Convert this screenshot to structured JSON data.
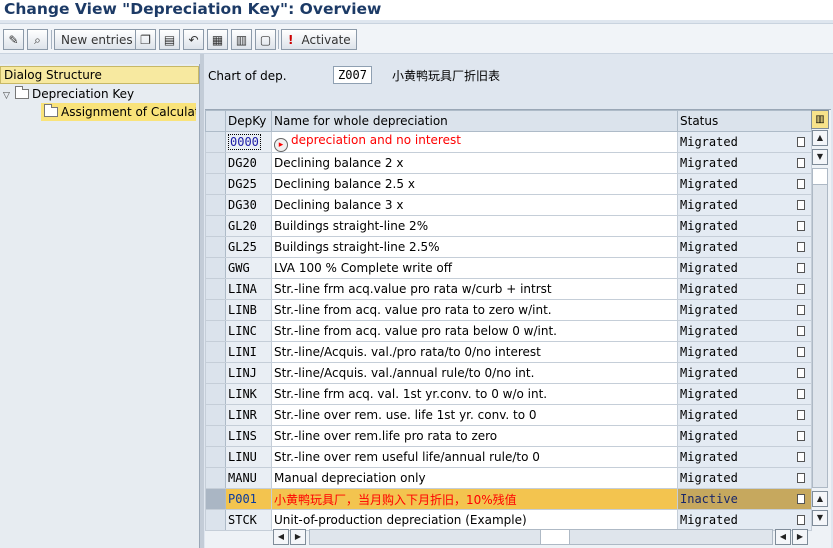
{
  "title": "Change View \"Depreciation Key\": Overview",
  "toolbar": {
    "new_entries_label": "New entries",
    "activate_label": "Activate"
  },
  "dialog_structure": {
    "header": "Dialog Structure",
    "nodes": [
      {
        "label": "Depreciation Key",
        "expanded": true
      },
      {
        "label": "Assignment of Calculatio",
        "selected": true
      }
    ]
  },
  "chart_of_dep": {
    "label": "Chart of dep.",
    "value": "Z007",
    "description": "小黄鸭玩具厂折旧表"
  },
  "table": {
    "columns": [
      "DepKy",
      "Name for whole depreciation",
      "Status"
    ],
    "rows": [
      {
        "key": "0000",
        "name": "depreciation and no interest",
        "status": "Migrated"
      },
      {
        "key": "DG20",
        "name": "Declining balance 2 x",
        "status": "Migrated"
      },
      {
        "key": "DG25",
        "name": "Declining balance 2.5 x",
        "status": "Migrated"
      },
      {
        "key": "DG30",
        "name": "Declining balance 3 x",
        "status": "Migrated"
      },
      {
        "key": "GL20",
        "name": "Buildings straight-line 2%",
        "status": "Migrated"
      },
      {
        "key": "GL25",
        "name": "Buildings straight-line 2.5%",
        "status": "Migrated"
      },
      {
        "key": "GWG",
        "name": "LVA 100 % Complete write off",
        "status": "Migrated"
      },
      {
        "key": "LINA",
        "name": "Str.-line frm acq.value pro rata w/curb + intrst",
        "status": "Migrated"
      },
      {
        "key": "LINB",
        "name": "Str.-line from acq. value pro rata to zero w/int.",
        "status": "Migrated"
      },
      {
        "key": "LINC",
        "name": "Str.-line from acq. value pro rata below 0 w/int.",
        "status": "Migrated"
      },
      {
        "key": "LINI",
        "name": "Str.-line/Acquis. val./pro rata/to 0/no interest",
        "status": "Migrated"
      },
      {
        "key": "LINJ",
        "name": "Str.-line/Acquis. val./annual rule/to 0/no int.",
        "status": "Migrated"
      },
      {
        "key": "LINK",
        "name": "Str.-line frm acq. val. 1st yr.conv. to 0 w/o int.",
        "status": "Migrated"
      },
      {
        "key": "LINR",
        "name": "Str.-line over rem. use. life 1st yr. conv. to 0",
        "status": "Migrated"
      },
      {
        "key": "LINS",
        "name": "Str.-line over rem.life pro rata to zero",
        "status": "Migrated"
      },
      {
        "key": "LINU",
        "name": "Str.-line over rem useful life/annual rule/to 0",
        "status": "Migrated"
      },
      {
        "key": "MANU",
        "name": "Manual depreciation only",
        "status": "Migrated"
      },
      {
        "key": "P001",
        "name": "小黄鸭玩具厂，当月购入下月折旧，10%残值",
        "status": "Inactive"
      },
      {
        "key": "STCK",
        "name": "Unit-of-production depreciation (Example)",
        "status": "Migrated"
      }
    ]
  },
  "icons": [
    "check-icon",
    "find-icon",
    "copy-icon",
    "delete-icon",
    "undo-icon",
    "select-all-icon",
    "select-block-icon",
    "deselect-all-icon",
    "activate-icon",
    "column-config-icon"
  ]
}
